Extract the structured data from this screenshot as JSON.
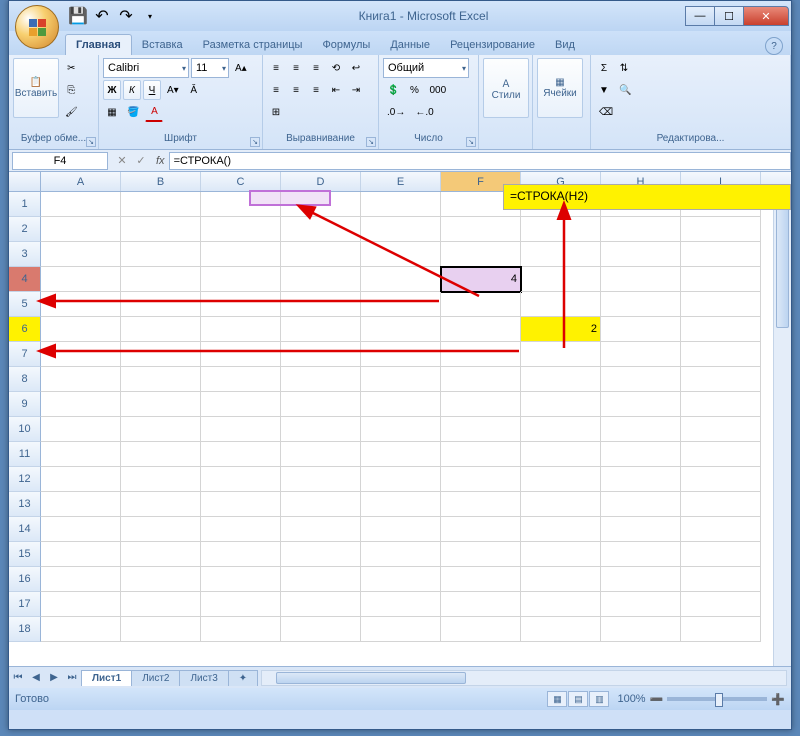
{
  "title": "Книга1 - Microsoft Excel",
  "tabs": [
    "Главная",
    "Вставка",
    "Разметка страницы",
    "Формулы",
    "Данные",
    "Рецензирование",
    "Вид"
  ],
  "active_tab": 0,
  "ribbon": {
    "clipboard_label": "Буфер обме...",
    "paste_label": "Вставить",
    "font_label": "Шрифт",
    "font_name": "Calibri",
    "font_size": "11",
    "bold": "Ж",
    "italic": "К",
    "underline": "Ч",
    "align_label": "Выравнивание",
    "number_label": "Число",
    "number_format": "Общий",
    "styles_label": "Стили",
    "cells_label": "Ячейки",
    "editing_label": "Редактирова..."
  },
  "namebox": "F4",
  "formula_bar": "=СТРОКА()",
  "annotation_formula2": "=СТРОКА(H2)",
  "columns": [
    "A",
    "B",
    "C",
    "D",
    "E",
    "F",
    "G",
    "H",
    "I"
  ],
  "selected_col_idx": 5,
  "rows_count": 18,
  "selected_row": 4,
  "hl_rows": {
    "4": "red",
    "6": "yel"
  },
  "cells": {
    "F4": "4",
    "G6": "2"
  },
  "sheets": [
    "Лист1",
    "Лист2",
    "Лист3"
  ],
  "active_sheet": 0,
  "status_text": "Готово",
  "zoom": "100%"
}
